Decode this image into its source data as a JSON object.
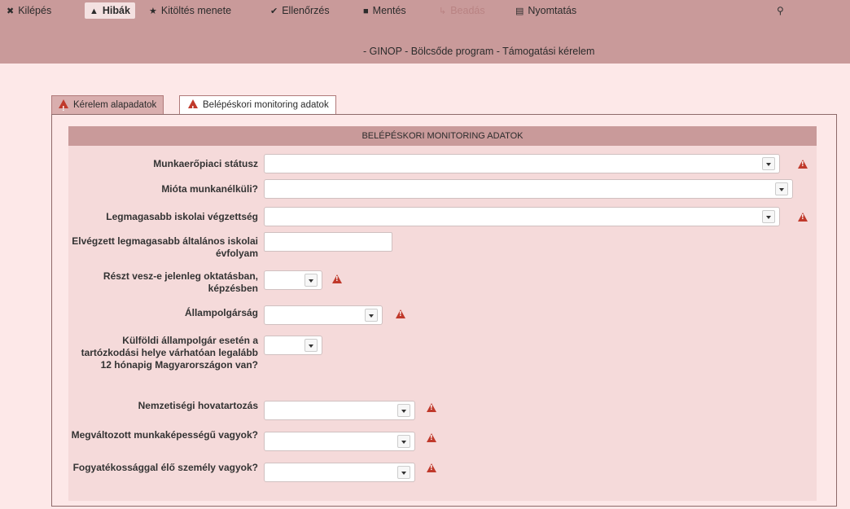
{
  "toolbar": {
    "items": [
      {
        "label": "Kilépés",
        "icon": "close-icon",
        "state": "normal"
      },
      {
        "label": "Hibák",
        "icon": "warning-icon",
        "state": "active"
      },
      {
        "label": "Kitöltés menete",
        "icon": "star-icon",
        "state": "normal"
      },
      {
        "label": "Ellenőrzés",
        "icon": "check-icon",
        "state": "normal"
      },
      {
        "label": "Mentés",
        "icon": "save-icon",
        "state": "normal"
      },
      {
        "label": "Beadás",
        "icon": "submit-icon",
        "state": "disabled"
      },
      {
        "label": "Nyomtatás",
        "icon": "print-icon",
        "state": "normal"
      }
    ],
    "user_icon": "user-icon"
  },
  "subtitle": "- GINOP - Bölcsőde program - Támogatási kérelem",
  "tabs": [
    {
      "label": "Kérelem alapadatok",
      "active": false,
      "icon": "warning-icon"
    },
    {
      "label": "Belépéskori monitoring adatok",
      "active": true,
      "icon": "warning-icon"
    }
  ],
  "panel": {
    "header": "BELÉPÉSKORI MONITORING ADATOK",
    "fields": [
      {
        "label": "Munkaerőpiaci státusz",
        "type": "select",
        "value": "",
        "warning": true
      },
      {
        "label": "Mióta munkanélküli?",
        "type": "select",
        "value": "",
        "warning": false
      },
      {
        "label": "Legmagasabb iskolai végzettség",
        "type": "select",
        "value": "",
        "warning": true
      },
      {
        "label": "Elvégzett legmagasabb általános iskolai évfolyam",
        "type": "text",
        "value": "",
        "warning": false
      },
      {
        "label": "Részt vesz-e jelenleg oktatásban, képzésben",
        "type": "select",
        "value": "",
        "warning": true
      },
      {
        "label": "Állampolgárság",
        "type": "select",
        "value": "",
        "warning": true
      },
      {
        "label": "Külföldi állampolgár esetén a tartózkodási helye várhatóan legalább 12 hónapig Magyarországon van?",
        "type": "select",
        "value": "",
        "warning": false
      },
      {
        "label": "Nemzetiségi hovatartozás",
        "type": "select",
        "value": "",
        "warning": true
      },
      {
        "label": "Megváltozott munkaképességű vagyok?",
        "type": "select",
        "value": "",
        "warning": true
      },
      {
        "label": "Fogyatékossággal élő személy vagyok?",
        "type": "select",
        "value": "",
        "warning": true
      }
    ]
  },
  "colors": {
    "topbar": "#c99a9a",
    "background": "#fde8e8",
    "warning": "#c0392b"
  }
}
